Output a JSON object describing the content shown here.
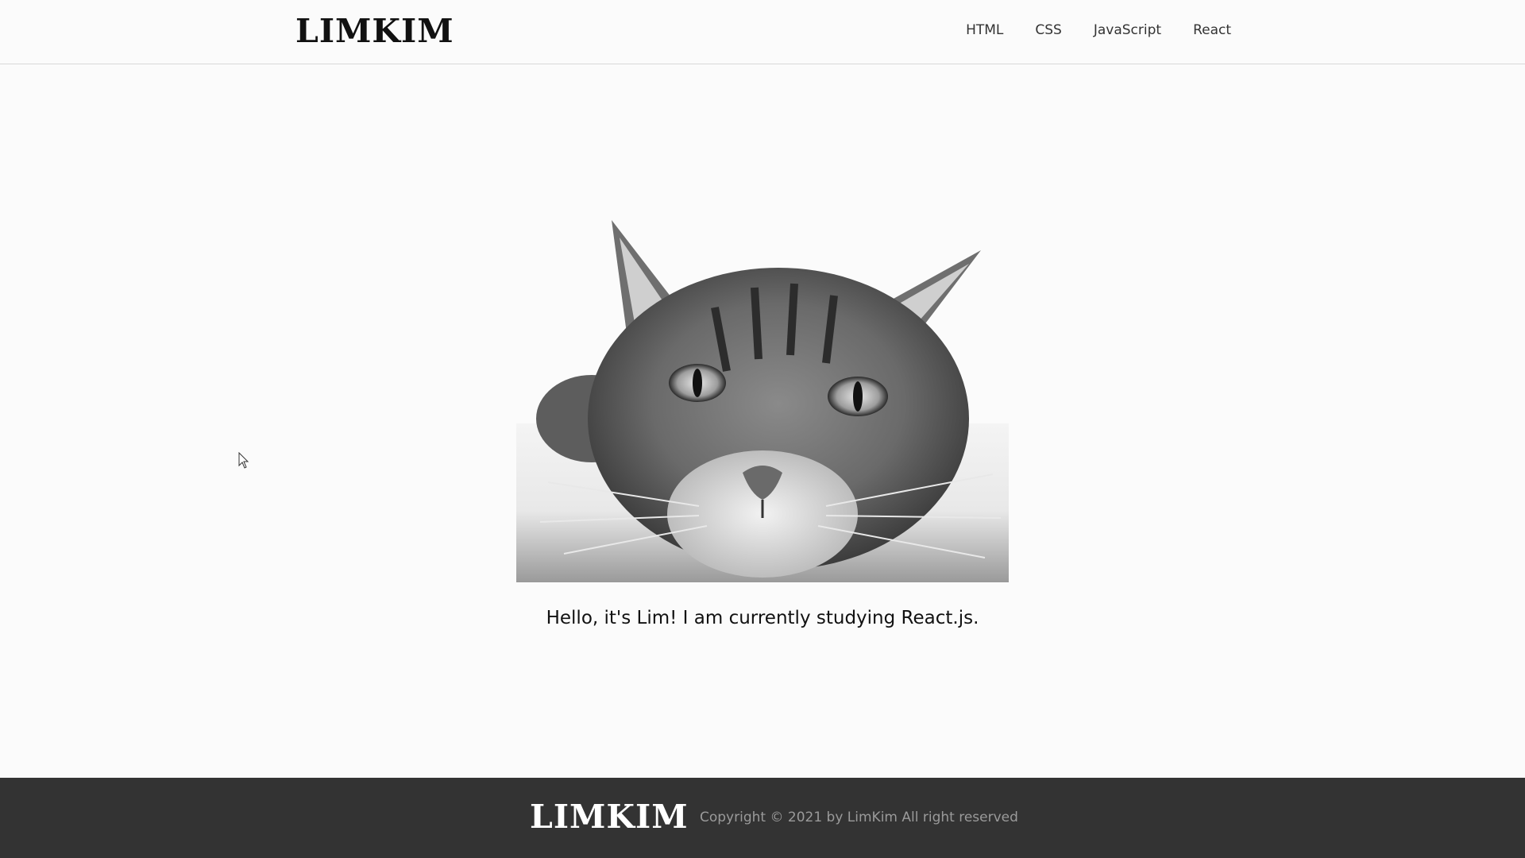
{
  "header": {
    "logo": "LIMKIM",
    "nav": [
      "HTML",
      "CSS",
      "JavaScript",
      "React"
    ]
  },
  "main": {
    "image_icon": "cat-photo",
    "caption": "Hello, it's Lim! I am currently studying React.js."
  },
  "footer": {
    "logo": "LIMKIM",
    "copyright": "Copyright © 2021 by LimKim All right reserved"
  },
  "colors": {
    "background": "#fbfbfb",
    "footer_bg": "#333333",
    "text": "#111111",
    "copyright": "#9a9a9a"
  }
}
